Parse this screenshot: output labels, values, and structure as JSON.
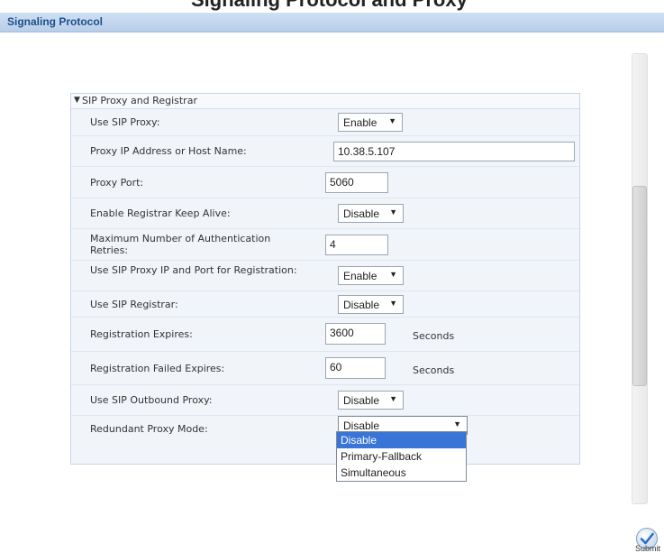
{
  "page_caption": "Signaling Protocol and Proxy",
  "window": {
    "title": "Signaling Protocol"
  },
  "group": {
    "title": "SIP Proxy and Registrar",
    "fields": [
      {
        "label": "Use SIP Proxy:",
        "type": "select",
        "value": "Enable"
      },
      {
        "label": "Proxy IP Address or Host Name:",
        "type": "input",
        "value": "10.38.5.107"
      },
      {
        "label": "Proxy Port:",
        "type": "input",
        "value": "5060"
      },
      {
        "label": "Enable Registrar Keep Alive:",
        "type": "select",
        "value": "Disable"
      },
      {
        "label": "Maximum Number of Authentication Retries:",
        "type": "input",
        "value": "4"
      },
      {
        "label": "Use SIP Proxy IP and Port for Registration:",
        "type": "select",
        "value": "Enable"
      },
      {
        "label": "Use SIP Registrar:",
        "type": "select",
        "value": "Disable"
      },
      {
        "label": "Registration Expires:",
        "type": "input",
        "value": "3600",
        "unit": "Seconds"
      },
      {
        "label": "Registration Failed Expires:",
        "type": "input",
        "value": "60",
        "unit": "Seconds"
      },
      {
        "label": "Use SIP Outbound Proxy:",
        "type": "select",
        "value": "Disable"
      },
      {
        "label": "Redundant Proxy Mode:",
        "type": "select",
        "value": "Disable"
      }
    ]
  },
  "dropdown": {
    "options": [
      "Disable",
      "Primary-Fallback",
      "Simultaneous"
    ],
    "highlighted": "Disable"
  },
  "submit": {
    "label": "Submit"
  }
}
